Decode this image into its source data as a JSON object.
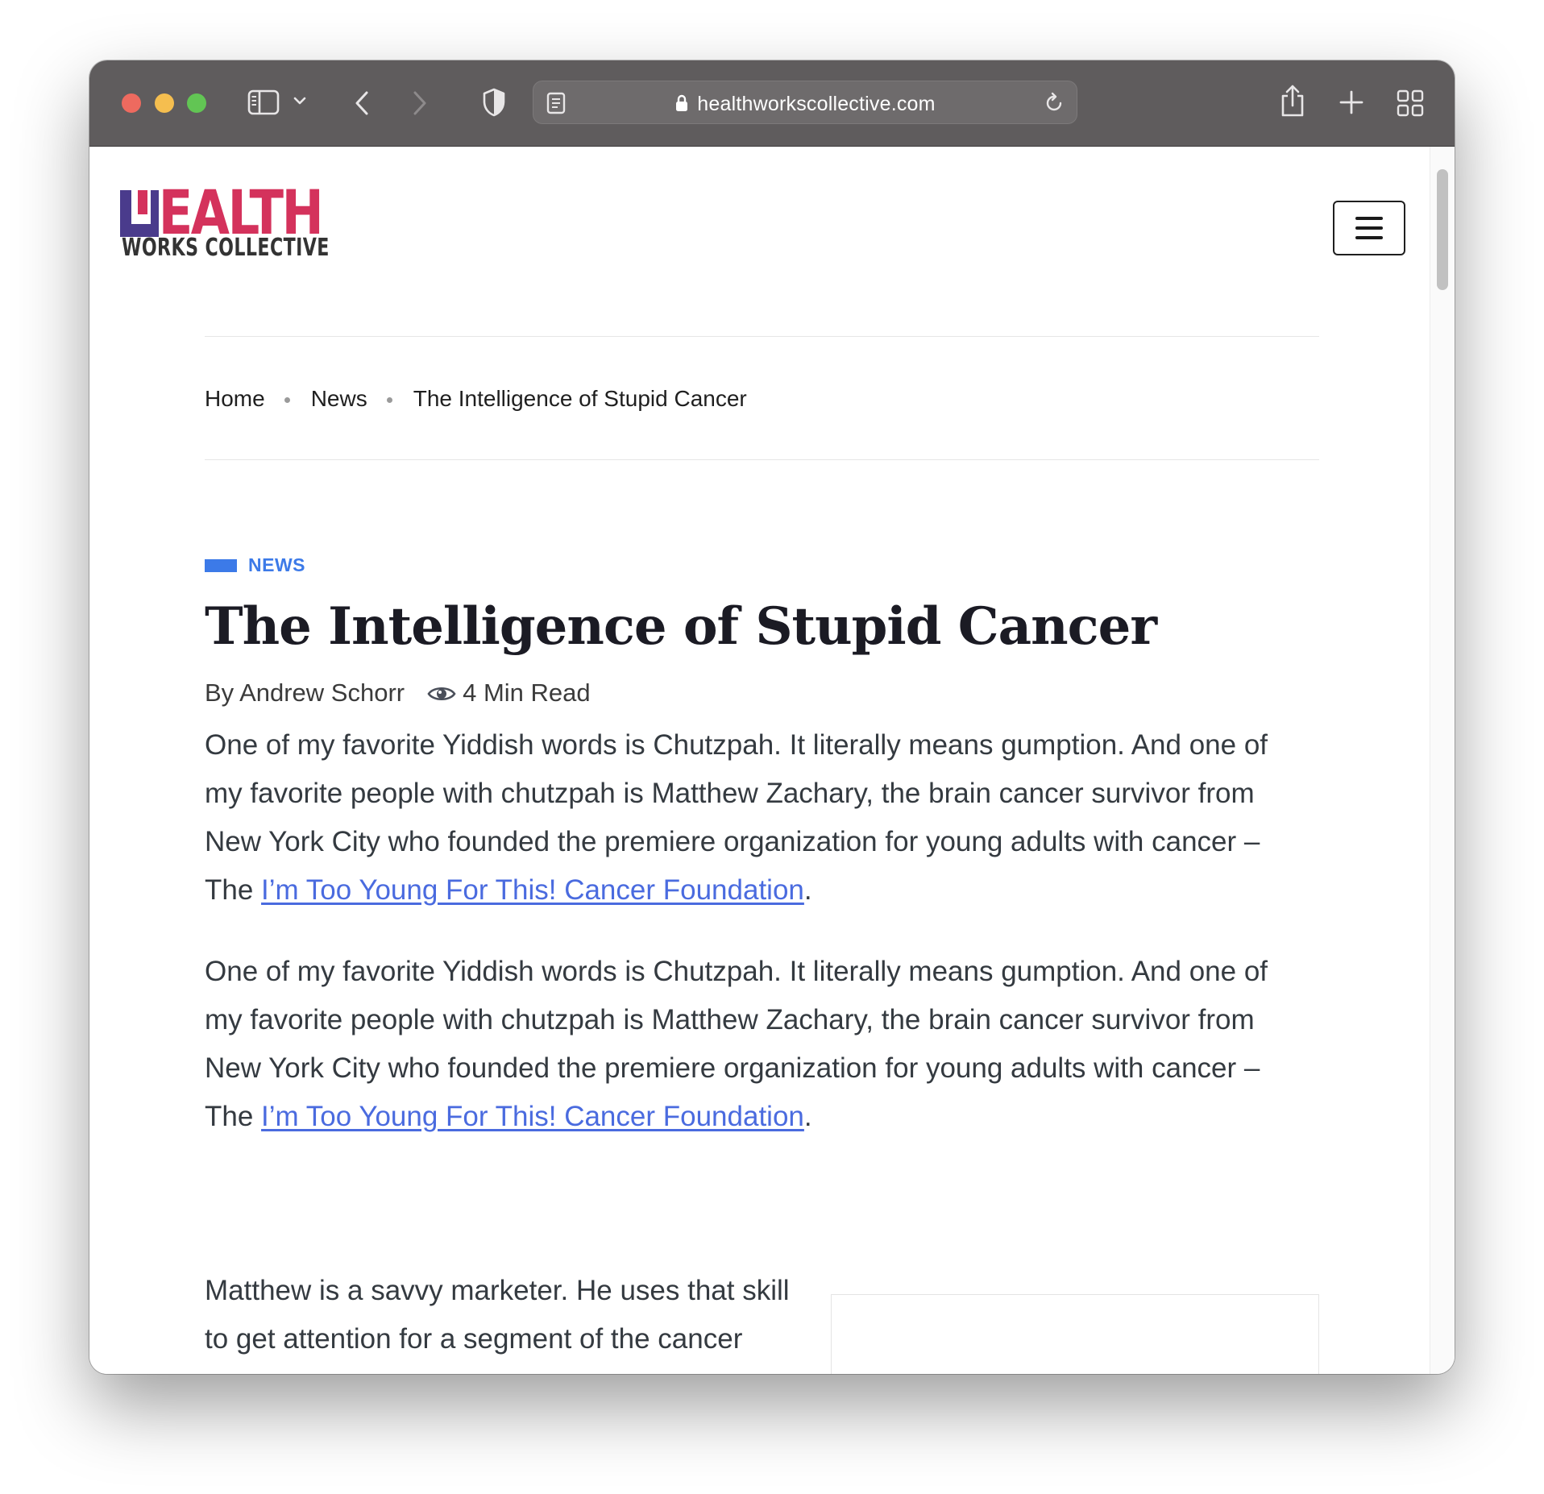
{
  "browser": {
    "url": "healthworkscollective.com"
  },
  "site": {
    "logo_top": "HEALTH",
    "logo_bottom": "WORKS COLLECTIVE"
  },
  "breadcrumb": {
    "items": [
      "Home",
      "News",
      "The Intelligence of Stupid Cancer"
    ]
  },
  "article": {
    "category": "NEWS",
    "title": "The Intelligence of Stupid Cancer",
    "author": "By Andrew Schorr",
    "read_time": "4 Min Read",
    "paragraphs": [
      {
        "text": "One of my favorite Yiddish words is Chutzpah. It literally means gumption. And one of my favorite people with chutzpah is Matthew Zachary, the brain cancer survivor from New York City who founded the premiere organization for young adults with cancer – The ",
        "link": "I’m Too Young For This! Cancer Foundation",
        "after": "."
      },
      {
        "text": "One of my favorite Yiddish words is Chutzpah. It literally means gumption. And one of my favorite people with chutzpah is Matthew Zachary, the brain cancer survivor from New York City who founded the premiere organization for young adults with cancer – The ",
        "link": "I’m Too Young For This! Cancer Foundation",
        "after": "."
      }
    ],
    "partial_paragraph": "Matthew is a savvy marketer. He uses that skill to get attention for a segment of the cancer population"
  },
  "colors": {
    "accent": "#3c7ae8",
    "link": "#4a6bdf",
    "logo_red": "#d4325c",
    "logo_purple": "#4a3b8c"
  }
}
